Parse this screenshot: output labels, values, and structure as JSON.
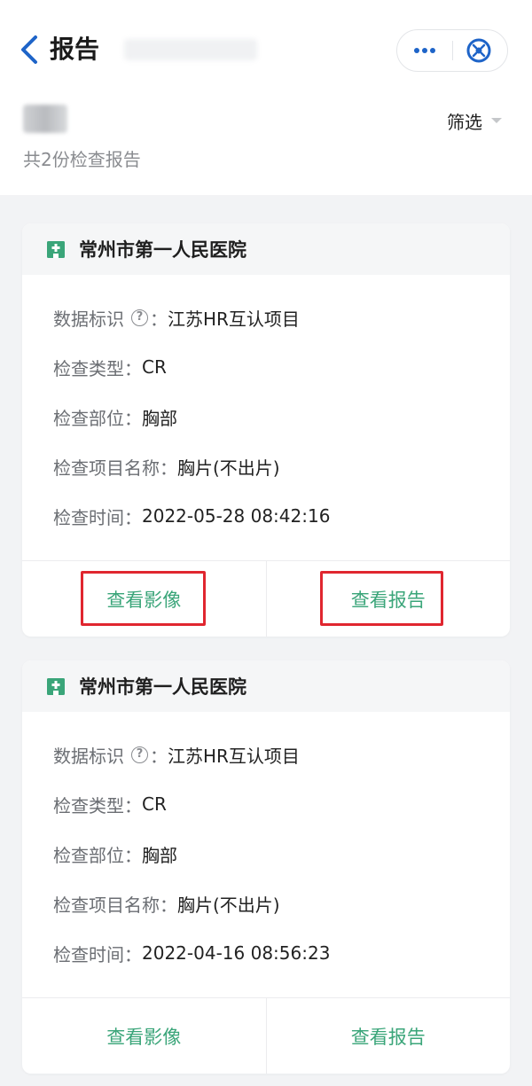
{
  "header": {
    "title": "报告",
    "back_icon": "chevron-left-icon",
    "more_icon": "more-dots-icon",
    "close_icon": "close-target-icon",
    "accent": "#1e64c8"
  },
  "subheader": {
    "filter_label": "筛选",
    "report_count": "共2份检查报告"
  },
  "colors": {
    "action_green": "#3aa579",
    "highlight_red": "#e0262f",
    "hospital_icon": "#3aa579"
  },
  "reports": [
    {
      "hospital": "常州市第一人民医院",
      "fields": [
        {
          "label": "数据标识",
          "value": "江苏HR互认项目",
          "help": true
        },
        {
          "label": "检查类型：",
          "value": "CR"
        },
        {
          "label": "检查部位：",
          "value": "胸部"
        },
        {
          "label": "检查项目名称：",
          "value": "胸片(不出片)"
        },
        {
          "label": "检查时间：",
          "value": "2022-05-28 08:42:16"
        }
      ],
      "actions": {
        "view_image": "查看影像",
        "view_report": "查看报告"
      }
    },
    {
      "hospital": "常州市第一人民医院",
      "fields": [
        {
          "label": "数据标识",
          "value": "江苏HR互认项目",
          "help": true
        },
        {
          "label": "检查类型：",
          "value": "CR"
        },
        {
          "label": "检查部位：",
          "value": "胸部"
        },
        {
          "label": "检查项目名称：",
          "value": "胸片(不出片)"
        },
        {
          "label": "检查时间：",
          "value": "2022-04-16 08:56:23"
        }
      ],
      "actions": {
        "view_image": "查看影像",
        "view_report": "查看报告"
      }
    }
  ]
}
